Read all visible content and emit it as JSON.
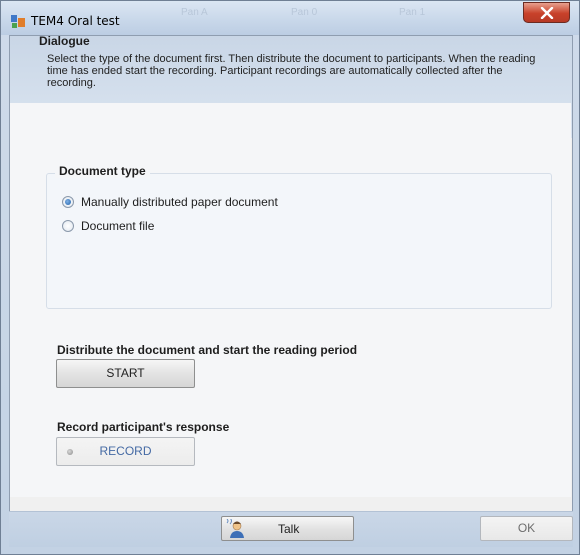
{
  "window": {
    "title": "TEM4 Oral test",
    "ghost_tabs": [
      "Pan A",
      "Pan 0",
      "Pan 1"
    ]
  },
  "dialogue": {
    "title": "Dialogue",
    "text": "Select the type of the document first. Then distribute the document to participants. When the reading time has ended start the recording. Participant recordings are automatically collected after the recording."
  },
  "document_type": {
    "legend": "Document type",
    "options": [
      {
        "label": "Manually distributed paper document",
        "selected": true
      },
      {
        "label": "Document file",
        "selected": false
      }
    ]
  },
  "distribute": {
    "label": "Distribute the document and start the reading period",
    "button": "START"
  },
  "record": {
    "label": "Record participant's response",
    "button": "RECORD"
  },
  "footer": {
    "talk_label": "Talk",
    "ok_label": "OK"
  },
  "icons": {
    "app": "app-icon",
    "close": "close-icon",
    "talk": "talk-icon",
    "led": "status-led-icon"
  }
}
